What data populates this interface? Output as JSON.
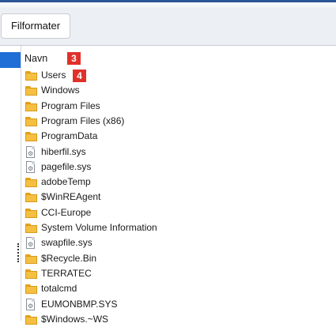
{
  "toolbar": {
    "filformater_label": "Filformater"
  },
  "header": {
    "column_name": "Navn",
    "badge_column": "3",
    "badge_users": "4"
  },
  "files": [
    {
      "name": "Users",
      "type": "folder"
    },
    {
      "name": "Windows",
      "type": "folder"
    },
    {
      "name": "Program Files",
      "type": "folder"
    },
    {
      "name": "Program Files (x86)",
      "type": "folder"
    },
    {
      "name": "ProgramData",
      "type": "folder"
    },
    {
      "name": "hiberfil.sys",
      "type": "file"
    },
    {
      "name": "pagefile.sys",
      "type": "file"
    },
    {
      "name": "adobeTemp",
      "type": "folder"
    },
    {
      "name": "$WinREAgent",
      "type": "folder"
    },
    {
      "name": "CCI-Europe",
      "type": "folder"
    },
    {
      "name": "System Volume Information",
      "type": "folder"
    },
    {
      "name": "swapfile.sys",
      "type": "file"
    },
    {
      "name": "$Recycle.Bin",
      "type": "folder"
    },
    {
      "name": "TERRATEC",
      "type": "folder"
    },
    {
      "name": "totalcmd",
      "type": "folder"
    },
    {
      "name": "EUMONBMP.SYS",
      "type": "file"
    },
    {
      "name": "$Windows.~WS",
      "type": "folder"
    }
  ],
  "colors": {
    "accent": "#2b5797",
    "selection": "#1f6fd6",
    "badge": "#e0302a",
    "folder": "#f5bf42"
  }
}
